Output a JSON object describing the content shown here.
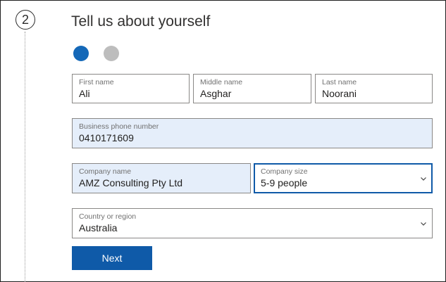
{
  "step": {
    "number": "2"
  },
  "form": {
    "title": "Tell us about yourself",
    "progress": {
      "current_step": 1,
      "total_steps": 2,
      "active_color": "#1468b8",
      "inactive_color": "#bdbdbd"
    },
    "fields": {
      "first_name": {
        "label": "First name",
        "value": "Ali"
      },
      "middle_name": {
        "label": "Middle name",
        "value": "Asghar"
      },
      "last_name": {
        "label": "Last name",
        "value": "Noorani"
      },
      "business_phone": {
        "label": "Business phone number",
        "value": "0410171609"
      },
      "company_name": {
        "label": "Company name",
        "value": "AMZ Consulting Pty Ltd"
      },
      "company_size": {
        "label": "Company size",
        "value": "5-9 people",
        "icon": "chevron-down-icon"
      },
      "country": {
        "label": "Country or region",
        "value": "Australia",
        "icon": "chevron-down-icon"
      }
    },
    "next_label": "Next",
    "accent_color": "#0f5aa8"
  }
}
